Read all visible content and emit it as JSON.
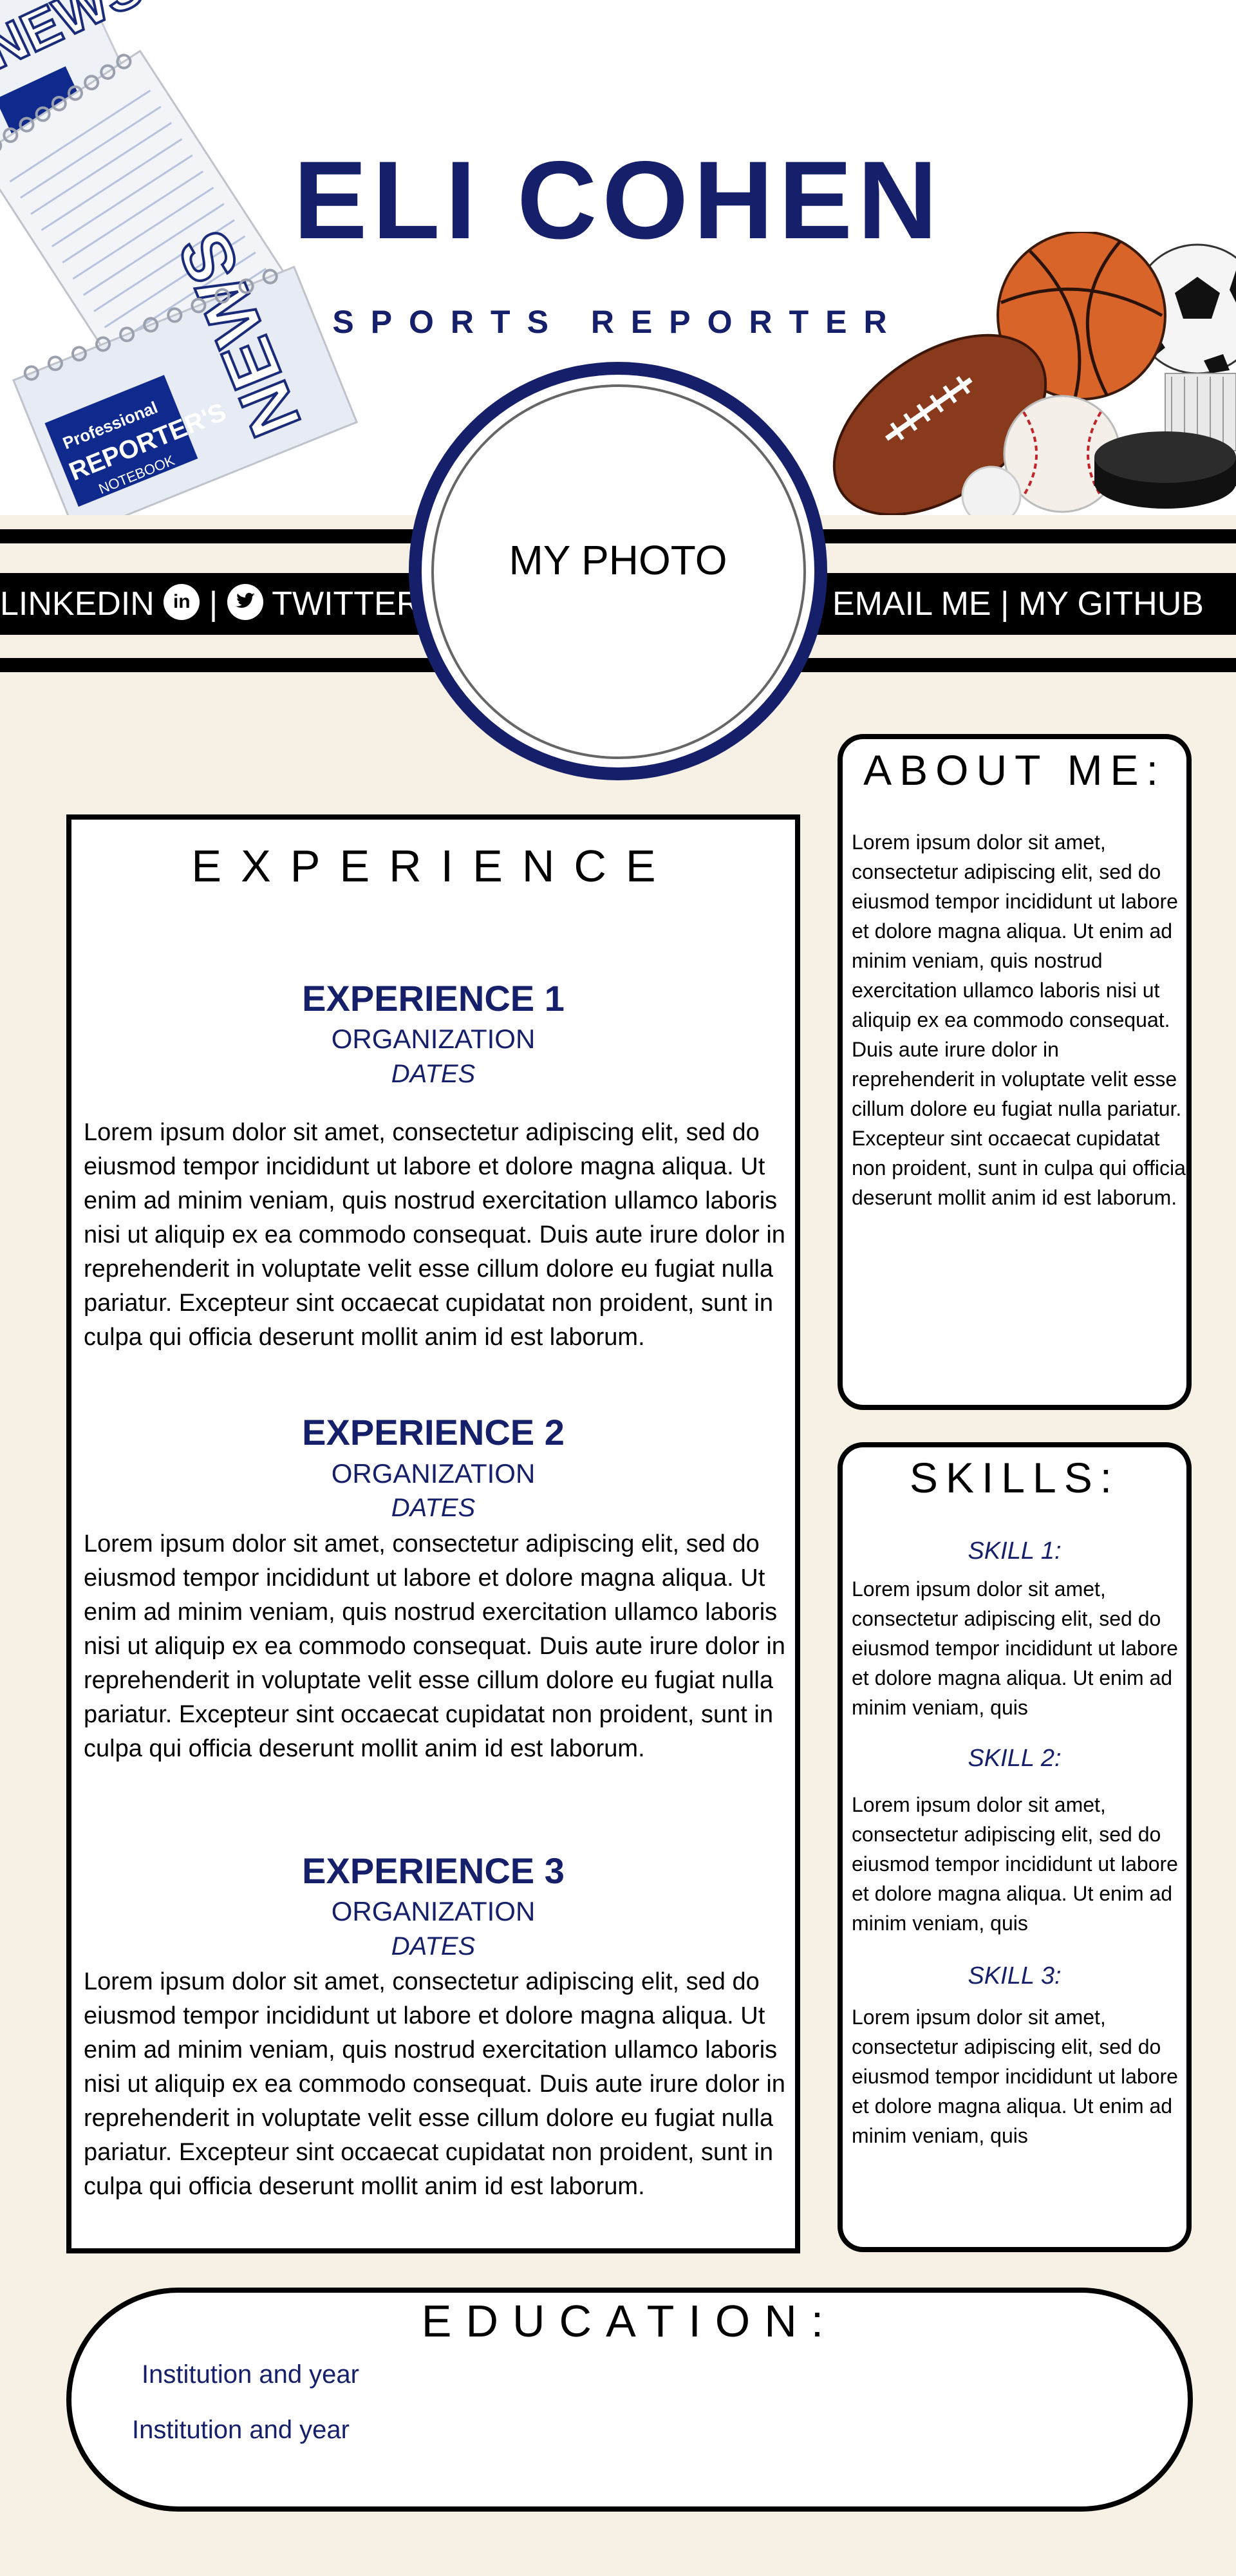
{
  "header": {
    "name": "ELI COHEN",
    "role": "SPORTS REPORTER"
  },
  "decor": {
    "notebook_text_1": "NEWS",
    "notebook_text_2": "NEWS",
    "notebook_subtext": "REPORTER'S",
    "notebook_small": "Professional",
    "notebook_small_2": "NOTEBOOK"
  },
  "social": {
    "linkedin": "LINKEDIN",
    "separator": "|",
    "twitter": "TWITTER",
    "email": "EMAIL ME",
    "github": "MY GITHUB",
    "linkedin_icon_glyph": "in"
  },
  "photo": {
    "label": "MY PHOTO"
  },
  "experience": {
    "title": "EXPERIENCE",
    "items": [
      {
        "name": "EXPERIENCE 1",
        "organization": "ORGANIZATION",
        "dates": "DATES",
        "description": "Lorem ipsum dolor sit amet, consectetur adipiscing elit, sed do eiusmod tempor incididunt ut labore et dolore magna aliqua. Ut enim ad minim veniam, quis nostrud exercitation ullamco laboris nisi ut aliquip ex ea commodo consequat. Duis aute irure dolor in reprehenderit in voluptate velit esse cillum dolore eu fugiat nulla pariatur. Excepteur sint occaecat cupidatat non proident, sunt in culpa qui officia deserunt mollit anim id est laborum."
      },
      {
        "name": "EXPERIENCE 2",
        "organization": "ORGANIZATION",
        "dates": "DATES",
        "description": "Lorem ipsum dolor sit amet, consectetur adipiscing elit, sed do eiusmod tempor incididunt ut labore et dolore magna aliqua. Ut enim ad minim veniam, quis nostrud exercitation ullamco laboris nisi ut aliquip ex ea commodo consequat. Duis aute irure dolor in reprehenderit in voluptate velit esse cillum dolore eu fugiat nulla pariatur. Excepteur sint occaecat cupidatat non proident, sunt in culpa qui officia deserunt mollit anim id est laborum."
      },
      {
        "name": "EXPERIENCE 3",
        "organization": "ORGANIZATION",
        "dates": "DATES",
        "description": "Lorem ipsum dolor sit amet, consectetur adipiscing elit, sed do eiusmod tempor incididunt ut labore et dolore magna aliqua. Ut enim ad minim veniam, quis nostrud exercitation ullamco laboris nisi ut aliquip ex ea commodo consequat. Duis aute irure dolor in reprehenderit in voluptate velit esse cillum dolore eu fugiat nulla pariatur. Excepteur sint occaecat cupidatat non proident, sunt in culpa qui officia deserunt mollit anim id est laborum."
      }
    ]
  },
  "about": {
    "title": "ABOUT ME:",
    "body": "Lorem ipsum dolor sit amet, consectetur adipiscing elit, sed do eiusmod tempor incididunt ut labore et dolore magna aliqua. Ut enim ad minim veniam, quis nostrud exercitation ullamco laboris nisi ut aliquip ex ea commodo consequat. Duis aute irure dolor in reprehenderit in voluptate velit esse cillum dolore eu fugiat nulla pariatur. Excepteur sint occaecat cupidatat non proident, sunt in culpa qui officia deserunt mollit anim id est laborum."
  },
  "skills": {
    "title": "SKILLS:",
    "items": [
      {
        "label": "SKILL 1:",
        "body": "Lorem ipsum dolor sit amet, consectetur adipiscing elit, sed do eiusmod tempor incididunt ut labore et dolore magna aliqua. Ut enim ad minim veniam, quis"
      },
      {
        "label": "SKILL 2:",
        "body": "Lorem ipsum dolor sit amet, consectetur adipiscing elit, sed do eiusmod tempor incididunt ut labore et dolore magna aliqua. Ut enim ad minim veniam, quis"
      },
      {
        "label": "SKILL 3:",
        "body": "Lorem ipsum dolor sit amet, consectetur adipiscing elit, sed do eiusmod tempor incididunt ut labore et dolore magna aliqua. Ut enim ad minim veniam, quis"
      }
    ]
  },
  "education": {
    "title": "EDUCATION:",
    "items": [
      "Institution and year",
      "Institution and year"
    ]
  },
  "colors": {
    "accent": "#16206a",
    "background": "#f6f0e5",
    "bar": "#000000"
  }
}
